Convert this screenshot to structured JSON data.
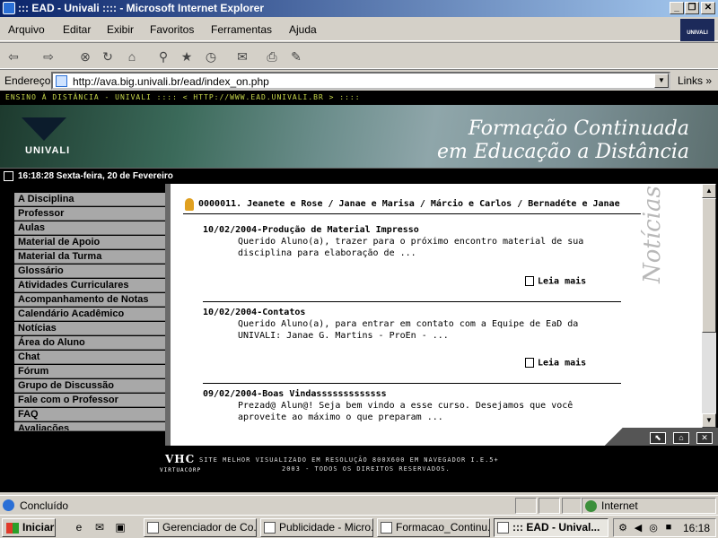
{
  "window": {
    "title": "::: EAD - Univali :::: - Microsoft Internet Explorer",
    "buttons": [
      "_",
      "❐",
      "✕"
    ]
  },
  "menubar": [
    "Arquivo",
    "Editar",
    "Exibir",
    "Favoritos",
    "Ferramentas",
    "Ajuda"
  ],
  "ie_logo": "UNIVALI",
  "toolbar_icons": [
    "back-icon",
    "forward-icon",
    "stop-icon",
    "refresh-icon",
    "home-icon",
    "search-icon",
    "favorites-icon",
    "history-icon",
    "mail-icon",
    "print-icon",
    "edit-icon"
  ],
  "address": {
    "label": "Endereço",
    "url": "http://ava.big.univali.br/ead/index_on.php",
    "links": "Links »"
  },
  "page": {
    "top_strip": "ENSINO À DISTÂNCIA - UNIVALI  ::::  < HTTP://WWW.EAD.UNIVALI.BR >  ::::",
    "banner": {
      "logo_text": "UNIVALI",
      "line1": "Formação Continuada",
      "line2": "em Educação a Distância"
    },
    "datetime": "16:18:28 Sexta-feira, 20 de Fevereiro",
    "nav": [
      "A Disciplina",
      "Professor",
      "Aulas",
      "Material de Apoio",
      "Material da Turma",
      "Glossário",
      "Atividades Curriculares",
      "Acompanhamento de Notas",
      "Calendário Acadêmico",
      "Notícias",
      "Área do Aluno",
      "Chat",
      "Fórum",
      "Grupo de Discussão",
      "Fale com o Professor",
      "FAQ",
      "Avaliações"
    ],
    "group_line": "0000011. Jeanete e Rose / Janae e Marisa / Márcio e Carlos / Bernadéte e Janae",
    "side_title": "Notícias",
    "news": [
      {
        "title": "10/02/2004-Produção de Material Impresso",
        "body": "Querido Aluno(a), trazer para o próximo encontro material de sua disciplina para elaboração de ...",
        "more": "Leia mais"
      },
      {
        "title": "10/02/2004-Contatos",
        "body": "Querido Aluno(a), para entrar em contato com a Equipe de EaD da UNIVALI: Janae G. Martins - ProEn - ...",
        "more": "Leia mais"
      },
      {
        "title": "09/02/2004-Boas Vindasssssssssssss",
        "body": "Prezad@ Alun@! Seja bem vindo a esse curso. Desejamos que você aproveite ao máximo o que preparam ...",
        "more": ""
      }
    ],
    "footer": {
      "logo": "VHC",
      "logo_sub": "VIRTUACORP",
      "line1": "SITE MELHOR VISUALIZADO EM RESOLUÇÃO 800X600 EM NAVEGADOR I.E.5+",
      "line2": "2003 - TODOS OS DIREITOS RESERVADOS."
    }
  },
  "status": {
    "text": "Concluído",
    "zone": "Internet"
  },
  "taskbar": {
    "start": "Iniciar",
    "tasks": [
      "Gerenciador de Co...",
      "Publicidade - Micro...",
      "Formacao_Continu...",
      "::: EAD - Unival..."
    ],
    "clock": "16:18"
  }
}
